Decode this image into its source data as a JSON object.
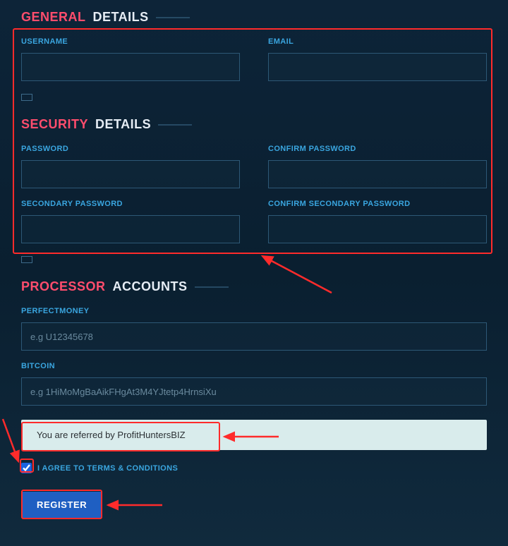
{
  "sections": {
    "general": {
      "accent": "GENERAL",
      "plain": "DETAILS"
    },
    "security": {
      "accent": "SECURITY",
      "plain": "DETAILS"
    },
    "processor": {
      "accent": "PROCESSOR",
      "plain": "ACCOUNTS"
    }
  },
  "fields": {
    "username": {
      "label": "USERNAME",
      "value": ""
    },
    "email": {
      "label": "EMAIL",
      "value": ""
    },
    "password": {
      "label": "PASSWORD",
      "value": ""
    },
    "confirm_password": {
      "label": "CONFIRM PASSWORD",
      "value": ""
    },
    "secondary_password": {
      "label": "SECONDARY PASSWORD",
      "value": ""
    },
    "confirm_secondary": {
      "label": "CONFIRM SECONDARY PASSWORD",
      "value": ""
    },
    "perfectmoney": {
      "label": "PERFECTMONEY",
      "placeholder": "e.g U12345678",
      "value": ""
    },
    "bitcoin": {
      "label": "BITCOIN",
      "placeholder": "e.g 1HiMoMgBaAikFHgAt3M4YJtetp4HrnsiXu",
      "value": ""
    }
  },
  "referral": {
    "text": "You are referred by ProfitHuntersBIZ"
  },
  "terms": {
    "label": "I AGREE TO TERMS & CONDITIONS",
    "checked": true
  },
  "buttons": {
    "register": "REGISTER"
  },
  "colors": {
    "accent_red": "#ff4d6d",
    "highlight_red": "#ff2b2b",
    "link_blue": "#3aa6e0",
    "button_blue": "#1f5fc2"
  }
}
